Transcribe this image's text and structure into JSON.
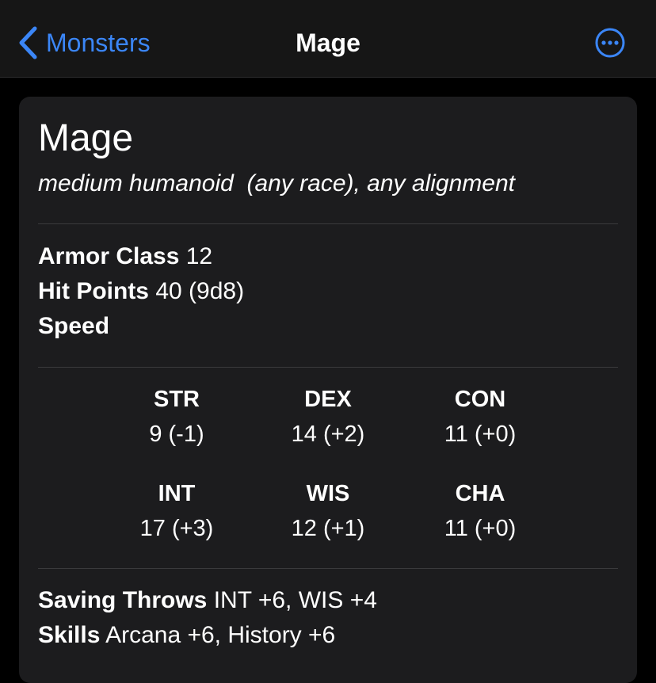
{
  "nav": {
    "back_label": "Monsters",
    "title": "Mage",
    "accent_color": "#3b86f7",
    "back_icon": "chevron-left-icon",
    "more_icon": "ellipsis-circle-icon"
  },
  "monster": {
    "name": "Mage",
    "subtitle": "medium humanoid  (any race), any alignment",
    "armor_class": {
      "label": "Armor Class",
      "value": "12"
    },
    "hit_points": {
      "label": "Hit Points",
      "value": "40 (9d8)"
    },
    "speed": {
      "label": "Speed",
      "value": ""
    },
    "abilities": [
      {
        "abbr": "STR",
        "score": "9 (-1)"
      },
      {
        "abbr": "DEX",
        "score": "14 (+2)"
      },
      {
        "abbr": "CON",
        "score": "11 (+0)"
      },
      {
        "abbr": "INT",
        "score": "17 (+3)"
      },
      {
        "abbr": "WIS",
        "score": "12 (+1)"
      },
      {
        "abbr": "CHA",
        "score": "11 (+0)"
      }
    ],
    "saving_throws": {
      "label": "Saving Throws",
      "value": "INT +6, WIS +4"
    },
    "skills": {
      "label": "Skills",
      "value": "Arcana +6, History +6"
    }
  }
}
